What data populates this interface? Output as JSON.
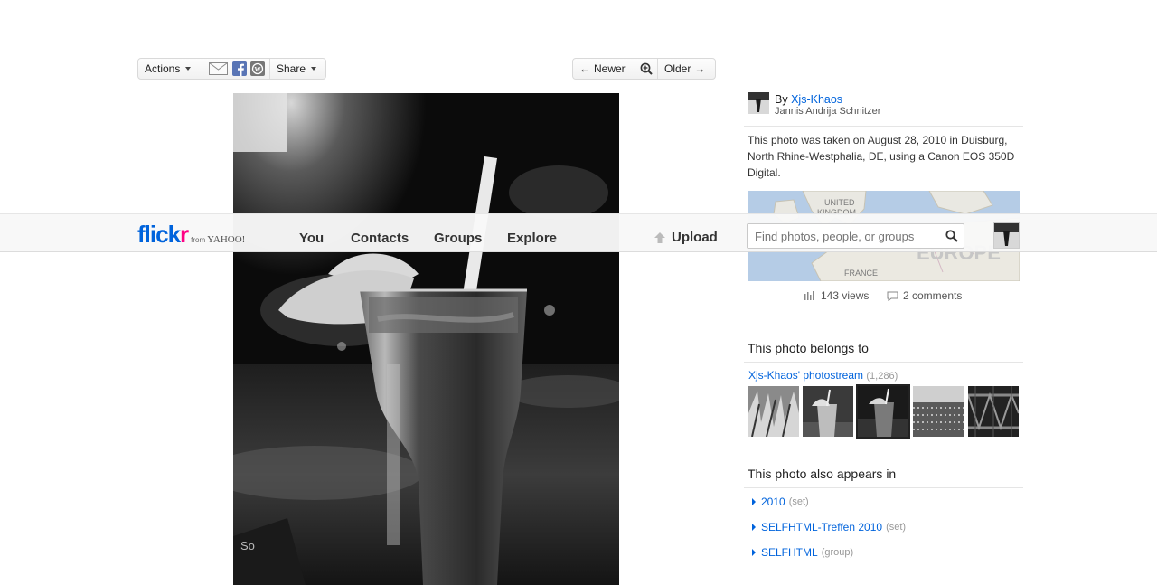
{
  "toolbar": {
    "actions_label": "Actions",
    "share_label": "Share",
    "newer_label": "Newer",
    "older_label": "Older"
  },
  "nav": {
    "logo_text": "flickr",
    "logo_sub_from": "from",
    "logo_sub_yahoo": "YAHOO!",
    "items": [
      "You",
      "Contacts",
      "Groups",
      "Explore"
    ],
    "upload_label": "Upload",
    "search_placeholder": "Find photos, people, or groups"
  },
  "owner": {
    "by_label": "By",
    "username": "Xjs-Khaos",
    "realname": "Jannis Andrija Schnitzer"
  },
  "photo_info": {
    "description": "This photo was taken on August 28, 2010 in Duisburg, North Rhine-Westphalia, DE, using a Canon EOS 350D Digital."
  },
  "map": {
    "labels": [
      "UNITED",
      "KINGDOM",
      "FRANCE",
      "EUROPE"
    ]
  },
  "stats": {
    "views": "143 views",
    "comments": "2 comments"
  },
  "belongs": {
    "title": "This photo belongs to",
    "stream_name": "Xjs-Khaos' photostream",
    "stream_count": "(1,286)"
  },
  "appears": {
    "title": "This photo also appears in",
    "items": [
      {
        "name": "2010",
        "type": "(set)"
      },
      {
        "name": "SELFHTML-Treffen 2010",
        "type": "(set)"
      },
      {
        "name": "SELFHTML",
        "type": "(group)"
      }
    ]
  },
  "colors": {
    "flickr_blue": "#0063dc",
    "flickr_pink": "#ff0084",
    "link": "#0063dc"
  }
}
